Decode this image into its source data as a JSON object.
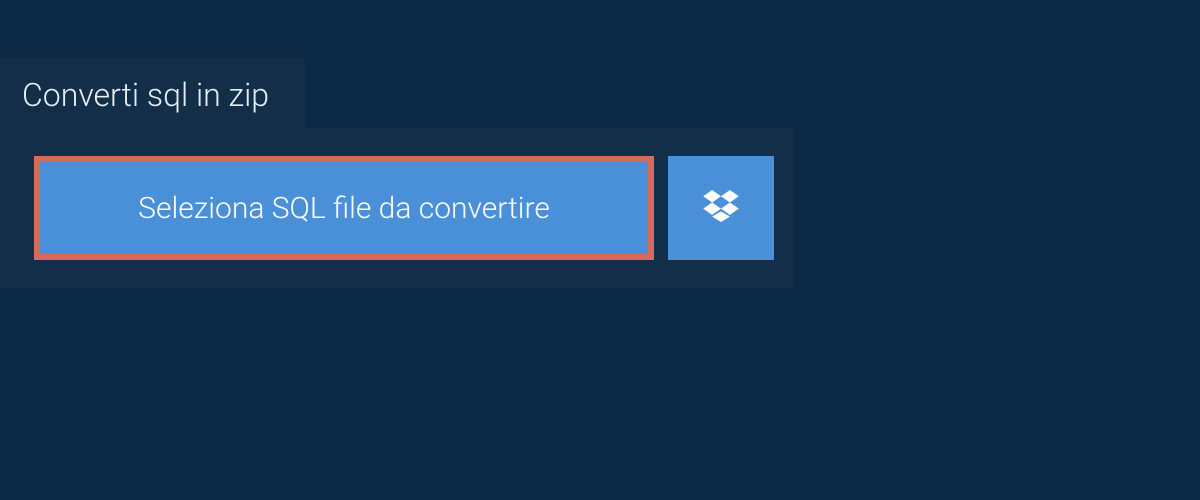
{
  "tab": {
    "title": "Converti sql in zip"
  },
  "upload": {
    "select_label": "Seleziona SQL file da convertire",
    "dropbox_icon": "dropbox"
  },
  "colors": {
    "page_bg": "#0c2a46",
    "panel_bg": "#132e49",
    "button_bg": "#4a90d9",
    "highlight_border": "#d86a5c"
  }
}
